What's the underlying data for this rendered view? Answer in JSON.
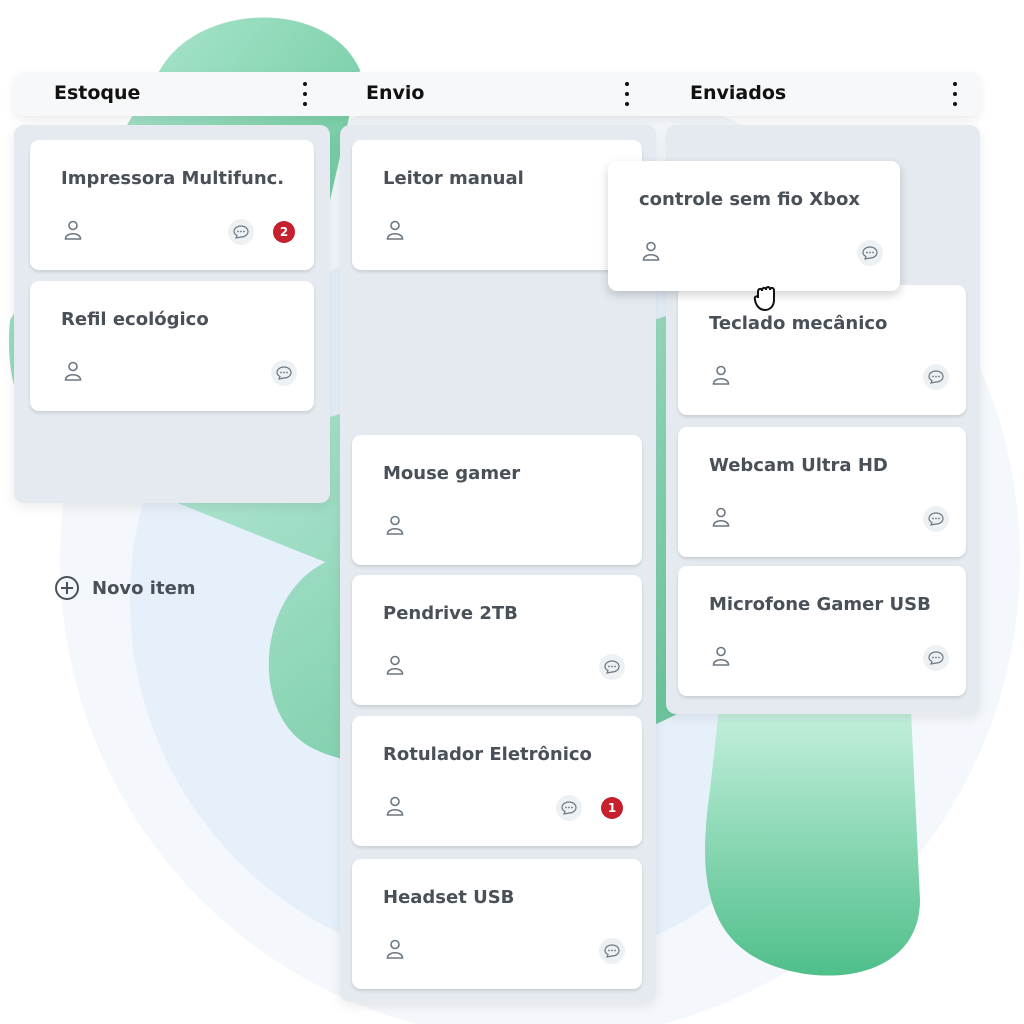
{
  "colors": {
    "accent_green": "#5cc79a",
    "badge_red": "#c4202e",
    "panel": "#e4eaf0",
    "text": "#4a5058"
  },
  "columns": [
    {
      "title": "Estoque",
      "menu_icon": "vertical-dots-icon",
      "cards": [
        {
          "title": "Impressora Multifunc.",
          "comment": true,
          "badge": "2"
        },
        {
          "title": "Refil ecológico",
          "comment": true,
          "badge": null
        }
      ],
      "add_label": "Novo item"
    },
    {
      "title": "Envio",
      "menu_icon": "vertical-dots-icon",
      "cards": [
        {
          "title": "Leitor manual",
          "comment": false,
          "badge": null
        },
        {
          "title": "Mouse gamer",
          "comment": false,
          "badge": null
        },
        {
          "title": "Pendrive 2TB",
          "comment": true,
          "badge": null
        },
        {
          "title": "Rotulador Eletrônico",
          "comment": true,
          "badge": "1"
        },
        {
          "title": "Headset USB",
          "comment": true,
          "badge": null
        }
      ]
    },
    {
      "title": "Enviados",
      "menu_icon": "vertical-dots-icon",
      "cards": [
        {
          "title": "Teclado mecânico",
          "comment": true,
          "badge": null
        },
        {
          "title": "Webcam Ultra HD",
          "comment": true,
          "badge": null
        },
        {
          "title": "Microfone Gamer USB",
          "comment": true,
          "badge": null
        }
      ]
    }
  ],
  "dragging_card": {
    "title": "controle sem fio Xbox",
    "comment": true,
    "badge": null,
    "cursor": "grab-hand-icon"
  }
}
